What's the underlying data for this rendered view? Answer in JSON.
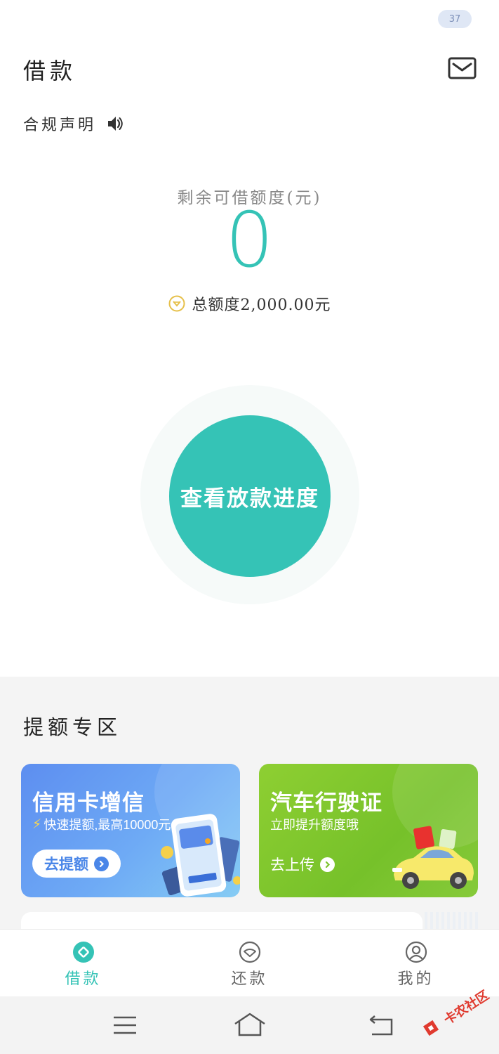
{
  "status_bar": {
    "badge": "37"
  },
  "header": {
    "title": "借款"
  },
  "compliance": {
    "label": "合规声明"
  },
  "quota": {
    "remaining_label": "剩余可借额度(元)",
    "remaining_value": "0",
    "total_text": "总额度2,000.00元"
  },
  "main_action": {
    "label": "查看放款进度"
  },
  "promo": {
    "section_title": "提额专区",
    "cards": [
      {
        "title": "信用卡增信",
        "subtitle": "快速提额,最高10000元",
        "action": "去提额"
      },
      {
        "title": "汽车行驶证",
        "subtitle": "立即提升额度哦",
        "action": "去上传"
      }
    ]
  },
  "tabs": [
    {
      "label": "借款",
      "active": true
    },
    {
      "label": "还款",
      "active": false
    },
    {
      "label": "我的",
      "active": false
    }
  ],
  "watermark": {
    "text": "卡农社区"
  },
  "colors": {
    "accent": "#35c3b6",
    "card_blue": "#5d8ef0",
    "card_green": "#86c62e"
  },
  "icons": [
    "mail-icon",
    "speaker-icon",
    "total-quota-icon",
    "chevron-right-icon",
    "loan-tab-icon",
    "repay-tab-icon",
    "profile-tab-icon",
    "menu-icon",
    "home-icon",
    "back-icon"
  ]
}
